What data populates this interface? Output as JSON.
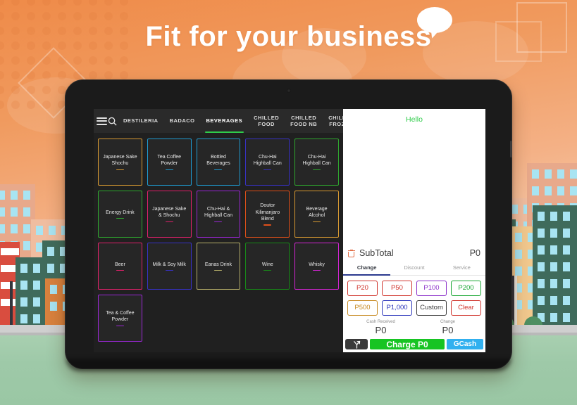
{
  "hero": {
    "headline": "Fit for your business",
    "bubble_icon": "speech-bubble-icon"
  },
  "pos": {
    "topbar": {
      "menu_icon": "hamburger-menu-icon",
      "search_icon": "search-icon",
      "categories": [
        {
          "label": "DESTILERIA",
          "active": false
        },
        {
          "label": "BADACO",
          "active": false
        },
        {
          "label": "BEVERAGES",
          "active": true
        },
        {
          "label": "CHILLED\nFOOD",
          "active": false
        },
        {
          "label": "CHILLED\nFOOD NB",
          "active": false
        },
        {
          "label": "CHILLED\nFROZEN",
          "active": false
        }
      ]
    },
    "products": [
      {
        "name": "Japanese Sake\nShochu",
        "color": "#d89a32"
      },
      {
        "name": "Tea  Coffee\nPowder",
        "color": "#1f9dd4"
      },
      {
        "name": "Bottled\nBeverages",
        "color": "#1f9dd4"
      },
      {
        "name": "Chu-Hai\nHighball Can",
        "color": "#3832c4"
      },
      {
        "name": "Chu-Hai\nHighball Can",
        "color": "#2fa82f"
      },
      {
        "name": "Energy Drink",
        "color": "#2fa82f"
      },
      {
        "name": "Japanese Sake\n& Shochu",
        "color": "#e0216b"
      },
      {
        "name": "Chu-Hai &\nHighball Can",
        "color": "#9b27d6"
      },
      {
        "name": "Doutor\nKilimanjaro\nBlend",
        "color": "#e0501a"
      },
      {
        "name": "Beverage\nAlcohol",
        "color": "#d89a32"
      },
      {
        "name": "Beer",
        "color": "#e0216b"
      },
      {
        "name": "Milk & Soy Milk",
        "color": "#3832c4"
      },
      {
        "name": "Eanas Drink",
        "color": "#b7b06a"
      },
      {
        "name": "Wine",
        "color": "#188a18"
      },
      {
        "name": "Whisky",
        "color": "#d425d4"
      },
      {
        "name": "Tea & Coffee\nPowder",
        "color": "#9b27d6"
      }
    ],
    "checkout": {
      "greeting": "Hello",
      "trash_icon": "trash-icon",
      "subtotal_label": "SubTotal",
      "subtotal_value": "P0",
      "tabs": [
        {
          "label": "Change",
          "active": true
        },
        {
          "label": "Discount",
          "active": false
        },
        {
          "label": "Service",
          "active": false
        }
      ],
      "denominations": [
        {
          "label": "P20",
          "color": "#d0342c",
          "border": "#d0342c"
        },
        {
          "label": "P50",
          "color": "#d0342c",
          "border": "#d0342c"
        },
        {
          "label": "P100",
          "color": "#8b30c9",
          "border": "#8b30c9"
        },
        {
          "label": "P200",
          "color": "#18a632",
          "border": "#18a632"
        },
        {
          "label": "P500",
          "color": "#c78a22",
          "border": "#c78a22"
        },
        {
          "label": "P1,000",
          "color": "#2b35bb",
          "border": "#2b35bb"
        },
        {
          "label": "Custom",
          "color": "#3a3a3a",
          "border": "#3a3a3a"
        },
        {
          "label": "Clear",
          "color": "#d0342c",
          "border": "#d0342c"
        }
      ],
      "cash_received_label": "Cash Received",
      "cash_received_value": "P0",
      "change_label": "Change",
      "change_value": "P0",
      "split_icon": "split-branch-icon",
      "charge_label": "Charge P0",
      "gcash_label": "GCash"
    }
  },
  "colors": {
    "brand_orange": "#ef8b49",
    "accent_green": "#2fcc4a",
    "charge_green": "#17c423",
    "gcash_blue": "#31b0ef",
    "tab_indigo": "#2b3a8f",
    "ground_green": "#9ec9a8"
  }
}
